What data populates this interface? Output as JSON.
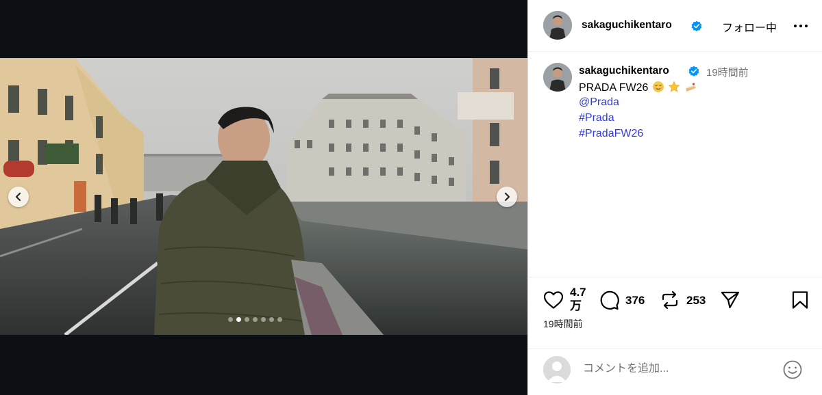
{
  "post": {
    "username": "sakaguchikentaro",
    "verified": true,
    "follow_status": "フォロー中",
    "caption_time": "19時間前",
    "caption_text": "PRADA  FW26",
    "caption_emojis": [
      "relieved-face",
      "star",
      "cake"
    ],
    "tags": [
      "@Prada",
      "#Prada",
      "#PradaFW26"
    ],
    "likes": "4.7万",
    "comments": "376",
    "reposts": "253",
    "post_time": "19時間前",
    "comment_placeholder": "コメントを追加..."
  },
  "carousel": {
    "total_slides": 7,
    "active_index": 1
  },
  "colors": {
    "link": "#2f3ad9",
    "verified": "#0095f6",
    "muted": "#737373",
    "media_bg": "#0c1014"
  },
  "icons": [
    "chevron-left-icon",
    "chevron-right-icon",
    "verified-icon",
    "more-icon",
    "heart-icon",
    "comment-icon",
    "repost-icon",
    "share-icon",
    "bookmark-icon",
    "smile-icon"
  ]
}
